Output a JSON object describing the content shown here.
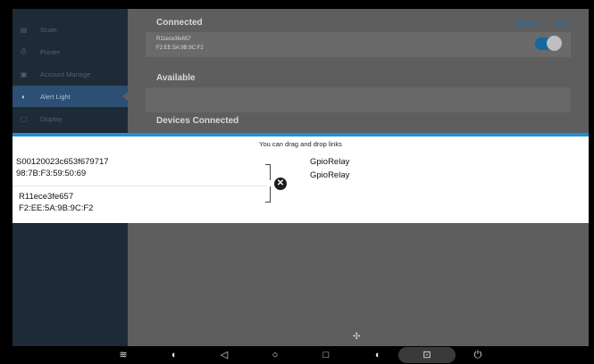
{
  "sidebar": {
    "items": [
      {
        "label": "Scale",
        "icon": "scale-icon",
        "glyph": "▤"
      },
      {
        "label": "Printer",
        "icon": "printer-icon",
        "glyph": "⎙"
      },
      {
        "label": "Account Manage",
        "icon": "account-icon",
        "glyph": "▣"
      },
      {
        "label": "Alert Light",
        "icon": "alert-light-icon",
        "glyph": "◐",
        "active": true
      },
      {
        "label": "Display",
        "icon": "display-icon",
        "glyph": "▢"
      }
    ]
  },
  "header": {
    "bound_label": "Bound",
    "exit_label": "Exit"
  },
  "connected": {
    "title": "Connected",
    "device": {
      "name": "R11ece3fe657",
      "mac": "F2:EE:5A:9B:9C:F2",
      "enabled": true
    }
  },
  "available": {
    "title": "Available"
  },
  "devices_connected": {
    "title": "Devices Connected"
  },
  "dialog": {
    "hint": "You can drag and drop links",
    "left_items": [
      {
        "name": "S00120023c653f679717",
        "mac": "98:7B:F3:59:50:69"
      },
      {
        "name": "R11ece3fe657",
        "mac": "F2:EE:5A:9B:9C:F2"
      }
    ],
    "right_items": [
      "GpioRelay",
      "GpioRelay"
    ],
    "unlink_glyph": "✕"
  },
  "navbar": {
    "icons": [
      {
        "name": "menu-icon",
        "glyph": "≋"
      },
      {
        "name": "volume-down-icon",
        "glyph": "◖"
      },
      {
        "name": "back-icon",
        "glyph": "◁"
      },
      {
        "name": "home-icon",
        "glyph": "○"
      },
      {
        "name": "recents-icon",
        "glyph": "□"
      },
      {
        "name": "volume-up-icon",
        "glyph": "◖"
      },
      {
        "name": "screenshot-icon",
        "glyph": "⊡"
      },
      {
        "name": "power-icon",
        "glyph": "⏻"
      }
    ]
  },
  "colors": {
    "accent": "#1e90d6",
    "toggle_on": "#1667a0",
    "sidebar_bg": "#1e2a36",
    "sidebar_active": "#2c4f73"
  },
  "spinner_glyph": "✣"
}
